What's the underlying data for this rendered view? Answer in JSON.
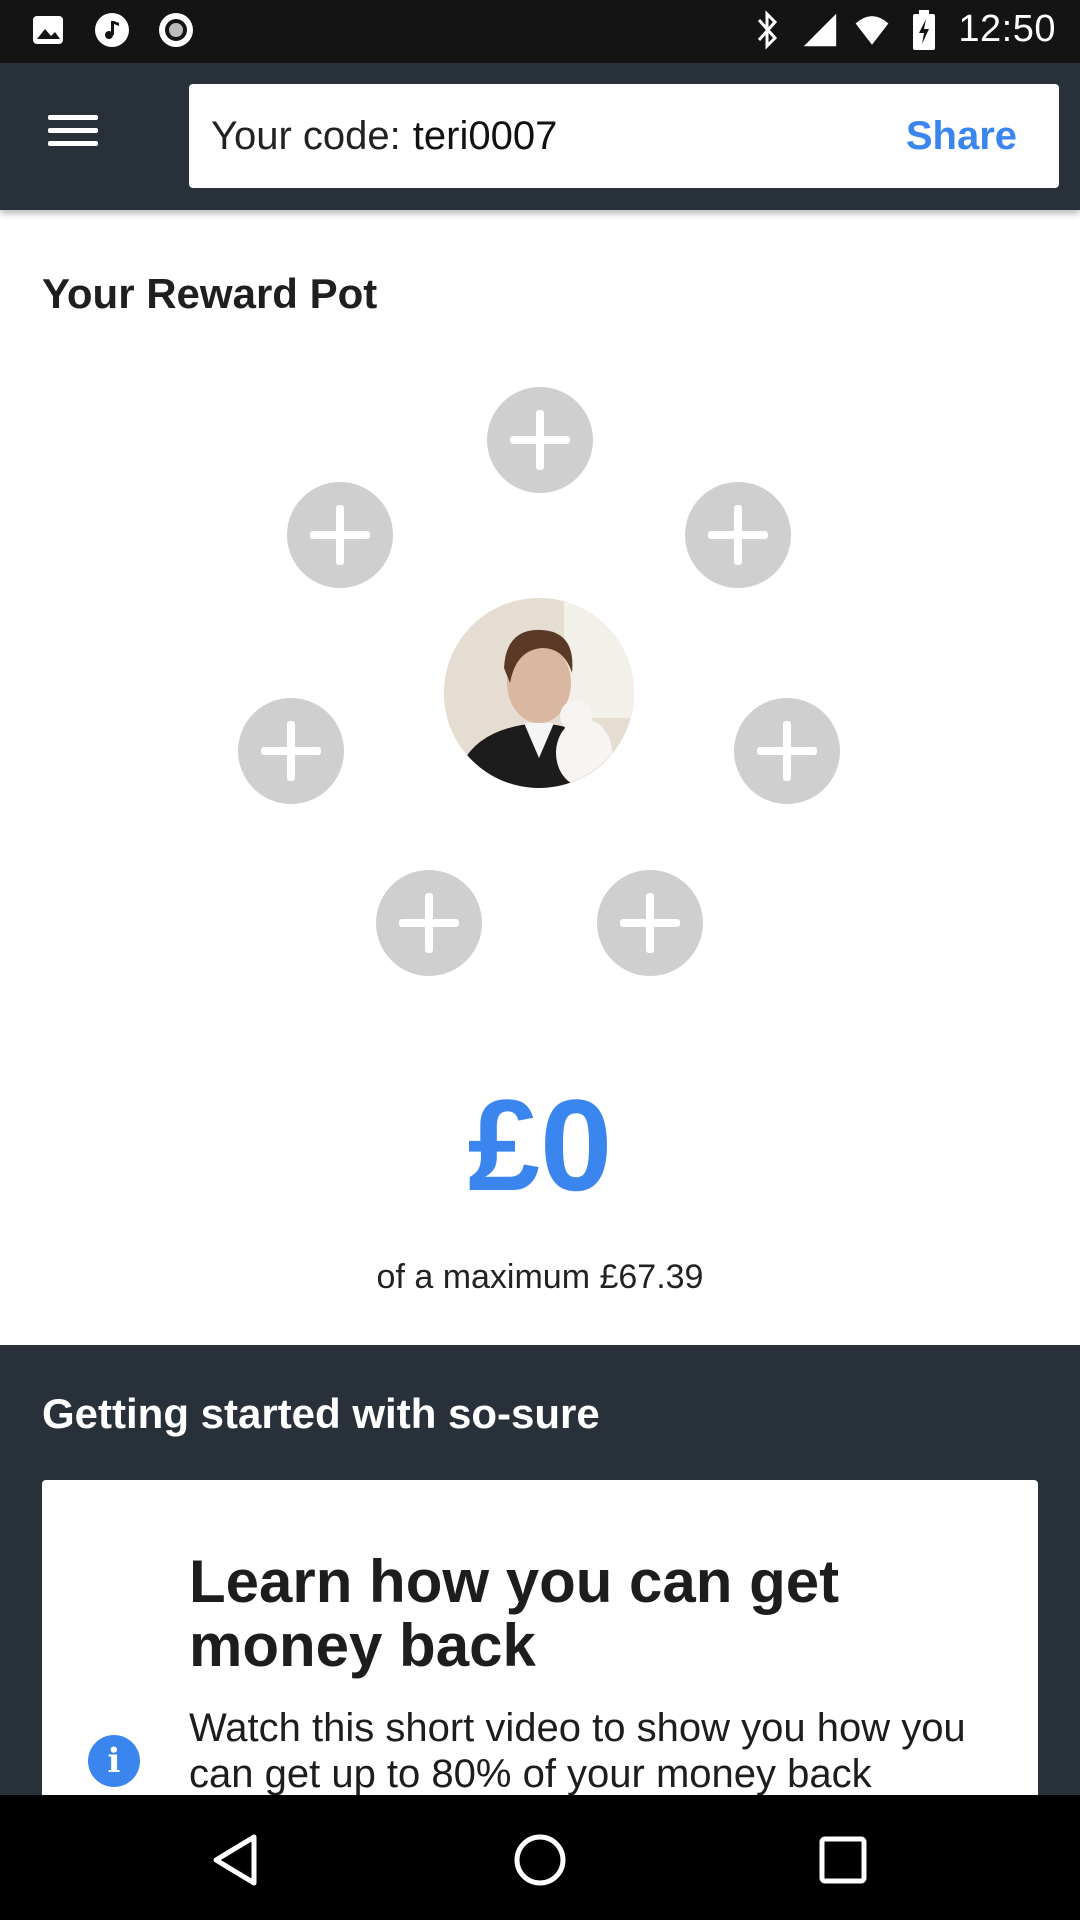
{
  "status_bar": {
    "time": "12:50",
    "left_icons": [
      "image-icon",
      "music-icon",
      "record-icon"
    ],
    "right_icons": [
      "bluetooth-icon",
      "signal-icon",
      "wifi-icon",
      "battery-charging-icon"
    ]
  },
  "app_bar": {
    "code_label": "Your code:",
    "code_value": "teri0007",
    "share_label": "Share",
    "menu_icon": "hamburger-menu-icon"
  },
  "reward_pot": {
    "title": "Your Reward Pot",
    "amount": "£0",
    "max_text": "of a maximum £67.39",
    "slot_icon": "add-icon",
    "empty_slots": 7
  },
  "getting_started": {
    "title": "Getting started with so-sure",
    "card": {
      "heading": "Learn how you can get money back",
      "body": "Watch this short video to show you how you can get up to 80% of your money back",
      "icon": "info-icon"
    }
  },
  "nav_bar": {
    "buttons": [
      "back-icon",
      "home-icon",
      "recents-icon"
    ]
  },
  "colors": {
    "accent": "#3a86ee",
    "dark": "#28313a",
    "slot": "#cfcfcf"
  }
}
